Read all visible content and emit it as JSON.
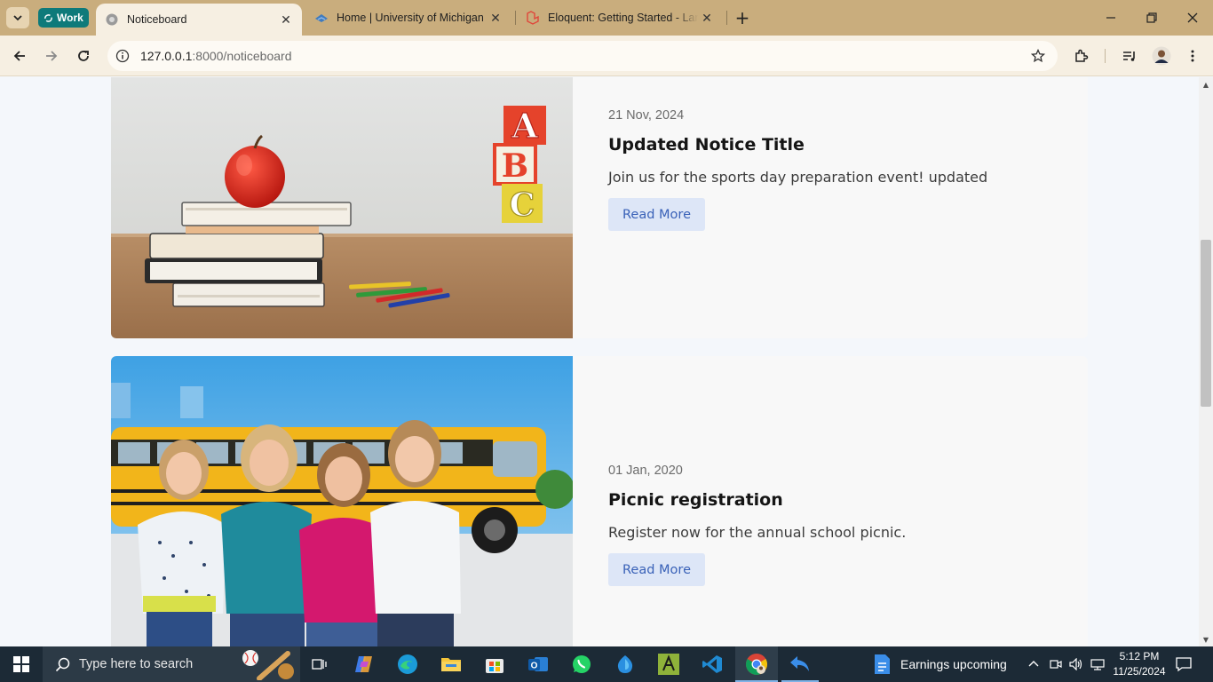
{
  "browser": {
    "work_badge": "Work",
    "tabs": [
      {
        "title": "Noticeboard",
        "active": true
      },
      {
        "title": "Home | University of Michigan",
        "active": false
      },
      {
        "title": "Eloquent: Getting Started - Laravel",
        "active": false
      }
    ],
    "url_host": "127.0.0.1",
    "url_rest": ":8000/noticeboard"
  },
  "notices": [
    {
      "date": "21 Nov, 2024",
      "title": "Updated Notice Title",
      "description": "Join us for the sports day preparation event! updated",
      "button": "Read More",
      "image": "apple-books-blocks-photo"
    },
    {
      "date": "01 Jan, 2020",
      "title": "Picnic registration",
      "description": "Register now for the annual school picnic.",
      "button": "Read More",
      "image": "girls-school-bus-photo"
    }
  ],
  "taskbar": {
    "search_placeholder": "Type here to search",
    "news_text": "Earnings upcoming",
    "time": "5:12 PM",
    "date": "11/25/2024"
  },
  "colors": {
    "tabbar": "#c9ad7d",
    "toolbar": "#f6efe2",
    "page_bg": "#f4f7fb",
    "button_bg": "#dde6f7",
    "button_text": "#3a62b8",
    "taskbar": "#1c2a36"
  }
}
